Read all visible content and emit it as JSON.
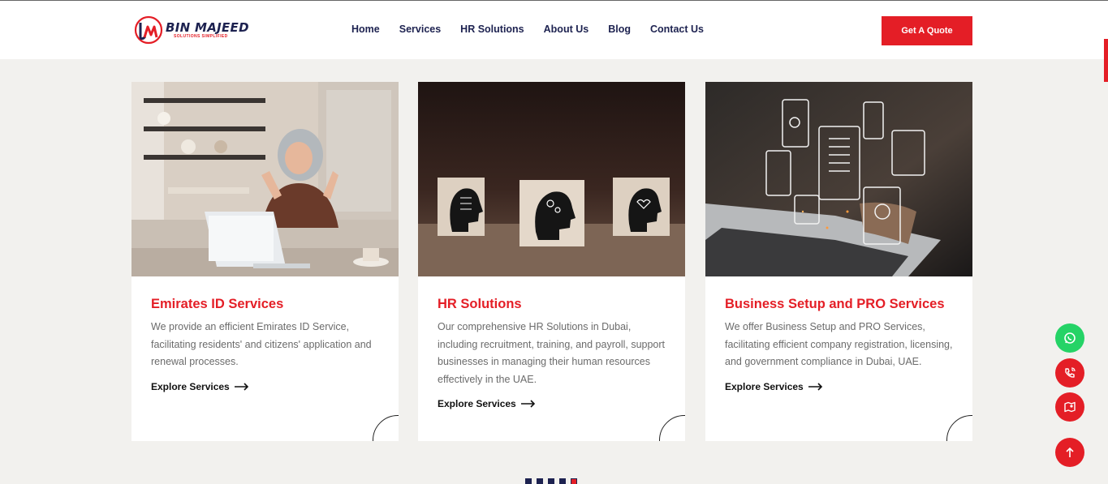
{
  "brand": {
    "name": "BIN MAJEED",
    "tagline": "SOLUTIONS SIMPLIFIED"
  },
  "nav": {
    "items": [
      {
        "label": "Home"
      },
      {
        "label": "Services"
      },
      {
        "label": "HR Solutions"
      },
      {
        "label": "About Us"
      },
      {
        "label": "Blog"
      },
      {
        "label": "Contact Us"
      }
    ],
    "cta_label": "Get A Quote"
  },
  "cards": [
    {
      "title": "Emirates ID Services",
      "description": "We provide an efficient Emirates ID Service, facilitating residents' and citizens' application and renewal processes.",
      "link_label": "Explore Services",
      "image": "woman-celebrating-at-laptop"
    },
    {
      "title": "HR Solutions",
      "description": "Our comprehensive HR Solutions in Dubai, including recruitment, training, and payroll, support businesses in managing their human resources effectively in the UAE.",
      "link_label": "Explore Services",
      "image": "wooden-blocks-with-head-icons"
    },
    {
      "title": "Business Setup and PRO Services",
      "description": "We offer Business Setup and PRO Services, facilitating efficient company registration, licensing, and government compliance in Dubai, UAE.",
      "link_label": "Explore Services",
      "image": "laptop-with-floating-document-icons"
    }
  ],
  "floating_actions": [
    {
      "icon": "whatsapp-icon",
      "color": "#25d366"
    },
    {
      "icon": "phone-icon",
      "color": "#e41e26"
    },
    {
      "icon": "map-icon",
      "color": "#e41e26"
    },
    {
      "icon": "arrow-up-icon",
      "color": "#e41e26"
    }
  ],
  "carousel": {
    "page_count": 5,
    "active_page": 5
  },
  "colors": {
    "accent": "#e41e26",
    "navy": "#1d2250",
    "background": "#f2f1ee"
  }
}
